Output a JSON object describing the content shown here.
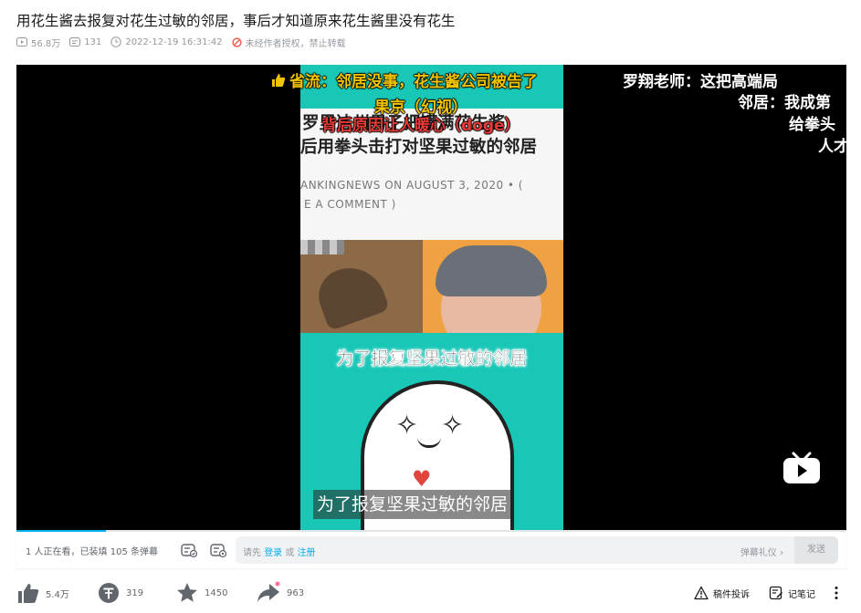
{
  "video": {
    "title": "用花生酱去报复对花生过敏的邻居，事后才知道原来花生酱里没有花生",
    "views": "56.8万",
    "danmaku_count": "131",
    "publish_time": "2022-12-19 16:31:42",
    "copyright": "未经作者授权，禁止转载"
  },
  "frame": {
    "article_title_1": "罗里达州男子把罐满花生酱",
    "article_title_2": "后用拳头击打对坚果过敏的邻居",
    "article_meta": "ANKINGNEWS ON AUGUST 3, 2020 • (",
    "article_comment": "E A COMMENT )",
    "caption": "为了报复坚果过敏的邻居"
  },
  "danmaku": {
    "line1": "省流：邻居没事，花生酱公司被告了",
    "line2": "果京（幻视）",
    "line3": "背后原因让人暖心（doge）",
    "line4": "罗翔老师：这把高端局",
    "line5": "邻居：我成第",
    "line6": "给拳头",
    "line7": "人才"
  },
  "subtitle": "为了报复坚果过敏的邻居",
  "danmaku_bar": {
    "viewers": "1 人正在看，已装填 105 条弹幕",
    "placeholder_prefix": "请先",
    "login": "登录",
    "or": "或",
    "register": "注册",
    "etiquette": "弹幕礼仪 ›",
    "send": "发送"
  },
  "toolbar": {
    "like": "5.4万",
    "coin": "319",
    "favorite": "1450",
    "share": "963",
    "report": "稿件投诉",
    "notes": "记笔记"
  },
  "colors": {
    "accent": "#00aeec",
    "danmaku_yellow": "#f2c400",
    "danmaku_red": "#e83a36",
    "frame_teal": "#19c7b7"
  },
  "playback": {
    "progress_fraction": 0.108
  }
}
